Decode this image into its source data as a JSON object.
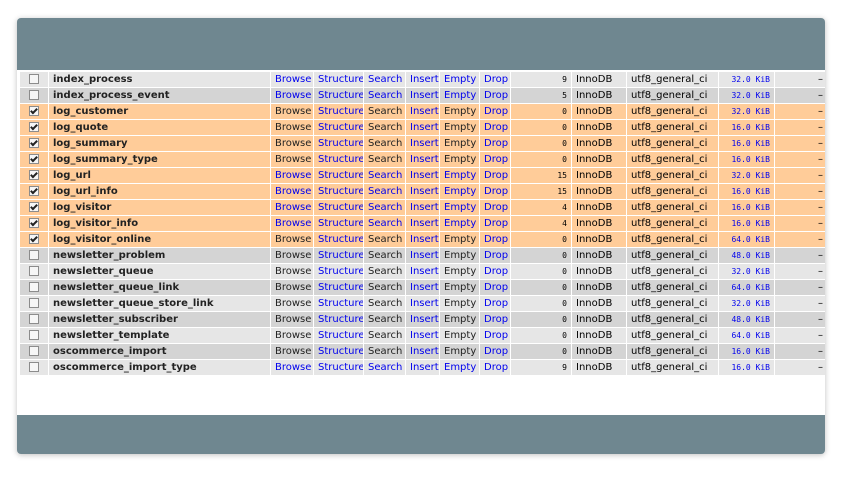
{
  "table_rows": [
    {
      "checked": false,
      "name": "index_process",
      "browse_active": true,
      "search_active": true,
      "empty_active": true,
      "rows": "9",
      "engine": "InnoDB",
      "collation": "utf8_general_ci",
      "size": "32.0 KiB",
      "overhead": "–"
    },
    {
      "checked": false,
      "name": "index_process_event",
      "browse_active": true,
      "search_active": true,
      "empty_active": true,
      "rows": "5",
      "engine": "InnoDB",
      "collation": "utf8_general_ci",
      "size": "32.0 KiB",
      "overhead": "–"
    },
    {
      "checked": true,
      "name": "log_customer",
      "browse_active": false,
      "search_active": false,
      "empty_active": false,
      "rows": "0",
      "engine": "InnoDB",
      "collation": "utf8_general_ci",
      "size": "32.0 KiB",
      "overhead": "–"
    },
    {
      "checked": true,
      "name": "log_quote",
      "browse_active": false,
      "search_active": false,
      "empty_active": false,
      "rows": "0",
      "engine": "InnoDB",
      "collation": "utf8_general_ci",
      "size": "16.0 KiB",
      "overhead": "–"
    },
    {
      "checked": true,
      "name": "log_summary",
      "browse_active": false,
      "search_active": false,
      "empty_active": false,
      "rows": "0",
      "engine": "InnoDB",
      "collation": "utf8_general_ci",
      "size": "16.0 KiB",
      "overhead": "–"
    },
    {
      "checked": true,
      "name": "log_summary_type",
      "browse_active": false,
      "search_active": false,
      "empty_active": false,
      "rows": "0",
      "engine": "InnoDB",
      "collation": "utf8_general_ci",
      "size": "16.0 KiB",
      "overhead": "–"
    },
    {
      "checked": true,
      "name": "log_url",
      "browse_active": true,
      "search_active": true,
      "empty_active": true,
      "rows": "15",
      "engine": "InnoDB",
      "collation": "utf8_general_ci",
      "size": "32.0 KiB",
      "overhead": "–"
    },
    {
      "checked": true,
      "name": "log_url_info",
      "browse_active": true,
      "search_active": true,
      "empty_active": true,
      "rows": "15",
      "engine": "InnoDB",
      "collation": "utf8_general_ci",
      "size": "16.0 KiB",
      "overhead": "–"
    },
    {
      "checked": true,
      "name": "log_visitor",
      "browse_active": true,
      "search_active": true,
      "empty_active": true,
      "rows": "4",
      "engine": "InnoDB",
      "collation": "utf8_general_ci",
      "size": "16.0 KiB",
      "overhead": "–"
    },
    {
      "checked": true,
      "name": "log_visitor_info",
      "browse_active": true,
      "search_active": true,
      "empty_active": true,
      "rows": "4",
      "engine": "InnoDB",
      "collation": "utf8_general_ci",
      "size": "16.0 KiB",
      "overhead": "–"
    },
    {
      "checked": true,
      "name": "log_visitor_online",
      "browse_active": false,
      "search_active": false,
      "empty_active": false,
      "rows": "0",
      "engine": "InnoDB",
      "collation": "utf8_general_ci",
      "size": "64.0 KiB",
      "overhead": "–"
    },
    {
      "checked": false,
      "name": "newsletter_problem",
      "browse_active": false,
      "search_active": false,
      "empty_active": false,
      "rows": "0",
      "engine": "InnoDB",
      "collation": "utf8_general_ci",
      "size": "48.0 KiB",
      "overhead": "–"
    },
    {
      "checked": false,
      "name": "newsletter_queue",
      "browse_active": false,
      "search_active": false,
      "empty_active": false,
      "rows": "0",
      "engine": "InnoDB",
      "collation": "utf8_general_ci",
      "size": "32.0 KiB",
      "overhead": "–"
    },
    {
      "checked": false,
      "name": "newsletter_queue_link",
      "browse_active": false,
      "search_active": false,
      "empty_active": false,
      "rows": "0",
      "engine": "InnoDB",
      "collation": "utf8_general_ci",
      "size": "64.0 KiB",
      "overhead": "–"
    },
    {
      "checked": false,
      "name": "newsletter_queue_store_link",
      "browse_active": false,
      "search_active": false,
      "empty_active": false,
      "rows": "0",
      "engine": "InnoDB",
      "collation": "utf8_general_ci",
      "size": "32.0 KiB",
      "overhead": "–"
    },
    {
      "checked": false,
      "name": "newsletter_subscriber",
      "browse_active": false,
      "search_active": false,
      "empty_active": false,
      "rows": "0",
      "engine": "InnoDB",
      "collation": "utf8_general_ci",
      "size": "48.0 KiB",
      "overhead": "–"
    },
    {
      "checked": false,
      "name": "newsletter_template",
      "browse_active": false,
      "search_active": false,
      "empty_active": false,
      "rows": "0",
      "engine": "InnoDB",
      "collation": "utf8_general_ci",
      "size": "64.0 KiB",
      "overhead": "–"
    },
    {
      "checked": false,
      "name": "oscommerce_import",
      "browse_active": false,
      "search_active": false,
      "empty_active": false,
      "rows": "0",
      "engine": "InnoDB",
      "collation": "utf8_general_ci",
      "size": "16.0 KiB",
      "overhead": "–"
    },
    {
      "checked": false,
      "name": "oscommerce_import_type",
      "browse_active": true,
      "search_active": true,
      "empty_active": true,
      "rows": "9",
      "engine": "InnoDB",
      "collation": "utf8_general_ci",
      "size": "16.0 KiB",
      "overhead": "–"
    }
  ],
  "actions": {
    "browse": "Browse",
    "structure": "Structure",
    "search": "Search",
    "insert": "Insert",
    "empty": "Empty",
    "drop": "Drop"
  },
  "colors": {
    "frame": "#6f8790",
    "row_odd": "#e6e6e6",
    "row_even": "#d4d4d4",
    "row_marked": "#ffcc99",
    "link": "#0000ee"
  }
}
